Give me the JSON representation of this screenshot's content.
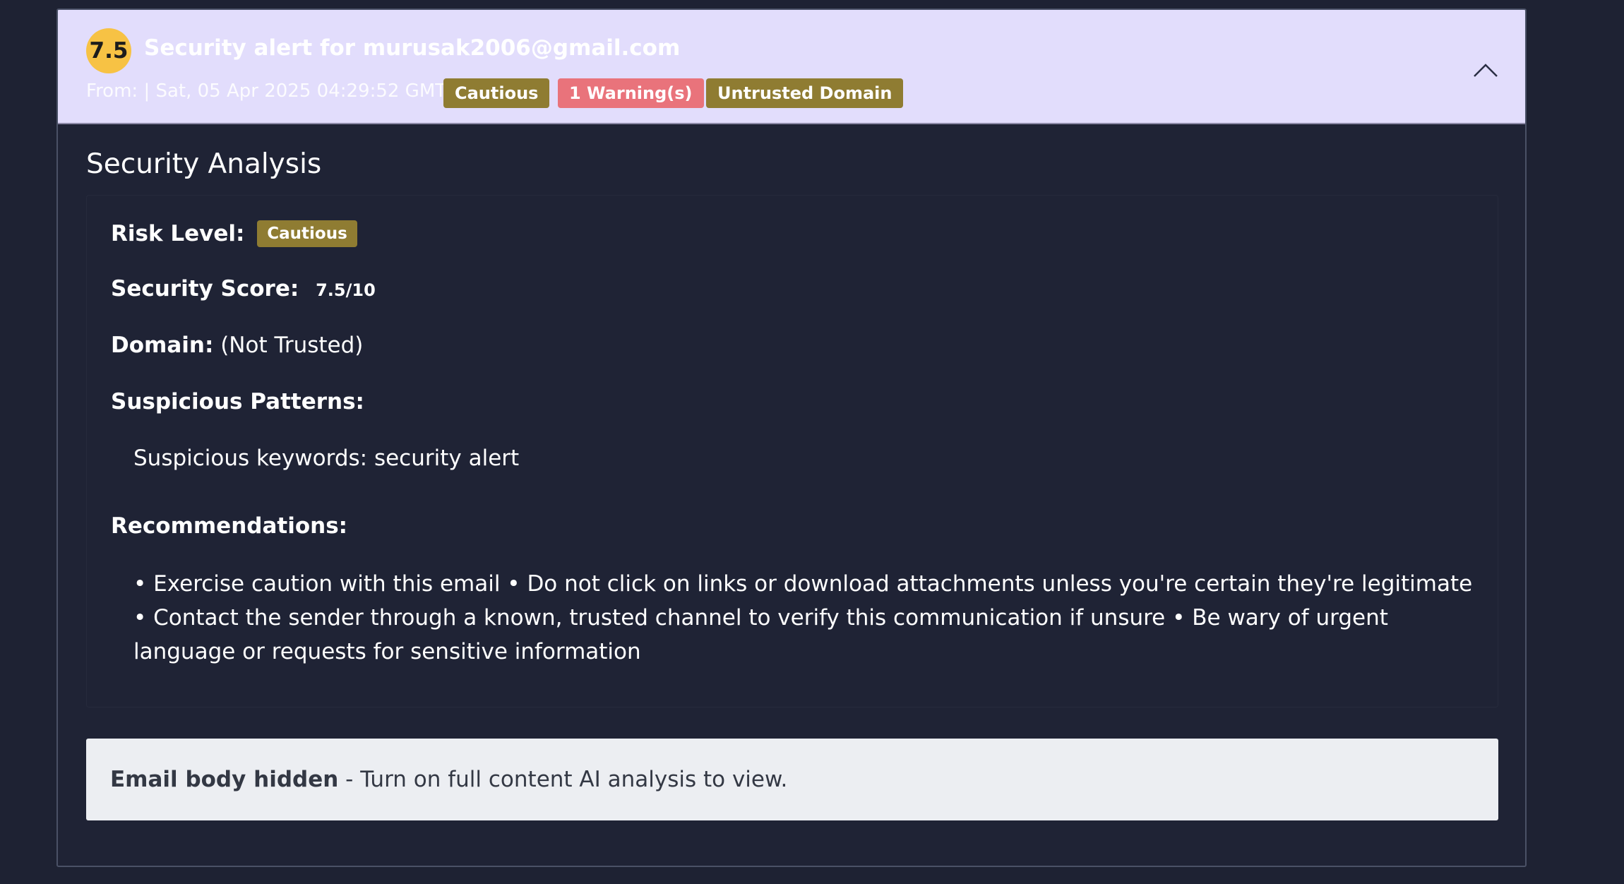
{
  "header": {
    "score": "7.5",
    "subject": "Security alert for murusak2006@gmail.com",
    "from": "From:  | Sat, 05 Apr 2025 04:29:52 GMT",
    "badges": {
      "risk": "Cautious",
      "warnings": "1 Warning(s)",
      "domain": "Untrusted Domain"
    }
  },
  "analysis": {
    "title": "Security Analysis",
    "risk_label": "Risk Level:",
    "risk_value": "Cautious",
    "score_label": "Security Score:",
    "score_value": "7.5/10",
    "domain_label": "Domain:",
    "domain_value": "(Not Trusted)",
    "patterns_label": "Suspicious Patterns:",
    "patterns_value": "Suspicious keywords: security alert",
    "recs_label": "Recommendations:",
    "recs_value": "• Exercise caution with this email • Do not click on links or download attachments unless you're certain they're legitimate • Contact the sender through a known, trusted channel to verify this communication if unsure • Be wary of urgent language or requests for sensitive information"
  },
  "body_notice": {
    "bold": "Email body hidden",
    "rest": " - Turn on full content AI analysis to view."
  },
  "colors": {
    "header_bg": "#e2ddfc",
    "score_circle": "#f7c244",
    "cautious_badge": "#8f7c32",
    "warning_badge": "#e9737b",
    "page_bg": "#1e2233"
  },
  "icons": {
    "collapse": "chevron-up-icon"
  }
}
